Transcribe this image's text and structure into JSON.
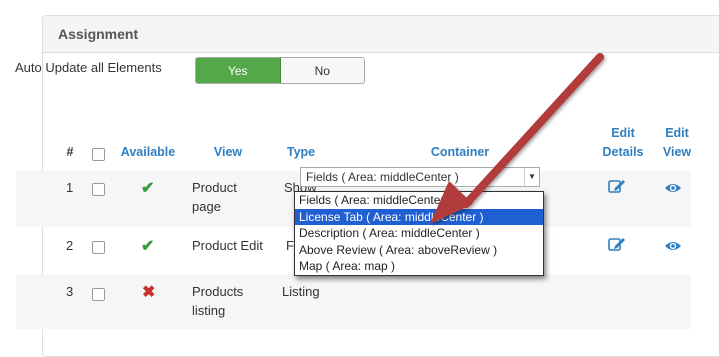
{
  "panel": {
    "title": "Assignment"
  },
  "auto_update": {
    "label": "Auto Update all Elements",
    "yes": "Yes",
    "no": "No",
    "selected": "Yes"
  },
  "table": {
    "headers": {
      "num": "#",
      "available": "Available",
      "view": "View",
      "type": "Type",
      "container": "Container",
      "edit_details": [
        "Edit",
        "Details"
      ],
      "edit_view": [
        "Edit",
        "View"
      ]
    },
    "rows": [
      {
        "num": "1",
        "available": "yes",
        "view": [
          "Product",
          "page"
        ],
        "type": "Show"
      },
      {
        "num": "2",
        "available": "yes",
        "view": [
          "Product Edit"
        ],
        "type": "Form"
      },
      {
        "num": "3",
        "available": "no",
        "view": [
          "Products",
          "listing"
        ],
        "type": "Listing"
      }
    ]
  },
  "container_select": {
    "value": "Fields ( Area: middleCenter )",
    "options": [
      "Fields ( Area: middleCenter )",
      "License Tab ( Area: middleCenter )",
      "Description ( Area: middleCenter )",
      "Above Review ( Area: aboveReview )",
      "Map ( Area: map )"
    ],
    "highlighted_index": 1
  },
  "icons": {
    "available_yes": "check-icon",
    "available_no": "cross-icon",
    "edit_details": "edit-icon",
    "edit_view": "eye-icon"
  },
  "colors": {
    "link_blue": "#2f7fc1",
    "yes_green": "#55a84a",
    "check_green": "#3c9a3c",
    "cross_red": "#c9302c",
    "highlight_blue": "#1f5fd1",
    "annotation_arrow": "#b23a3a"
  }
}
